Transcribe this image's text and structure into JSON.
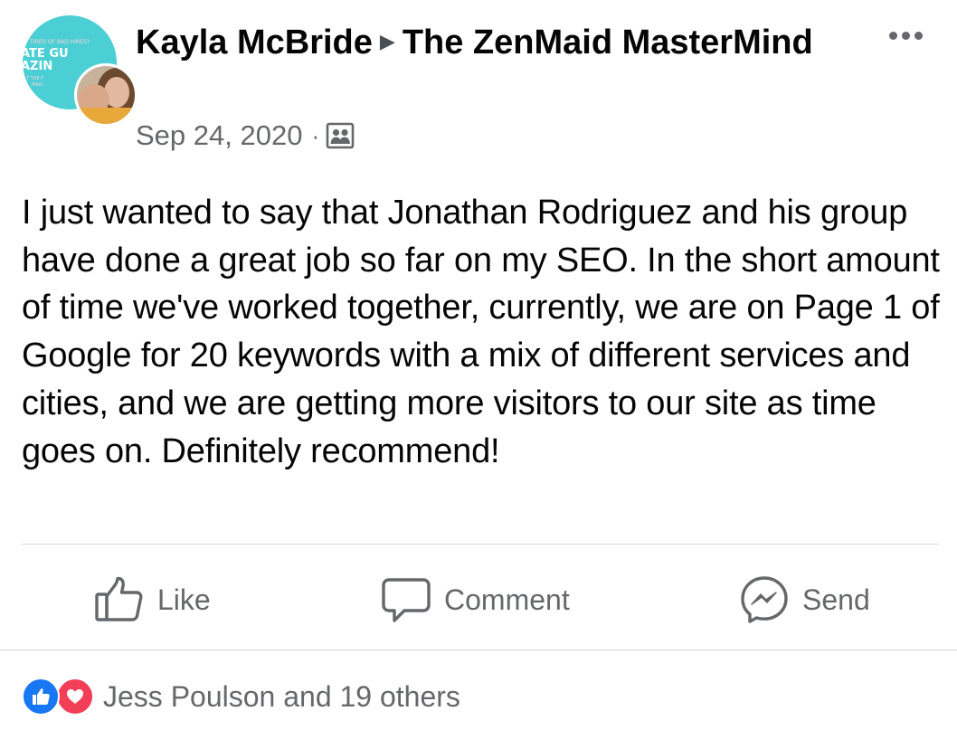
{
  "post": {
    "author": "Kayla McBride",
    "separator": "▶",
    "group": "The ZenMaid MasterMind",
    "date": "Sep 24, 2020",
    "meta_dot": "·",
    "privacy_icon": "group-members-icon",
    "more_icon": "more-options-icon",
    "text": "I just wanted to say that Jonathan Rodriguez and his group have done a great job so far on my SEO. In the short amount of time we've worked together, currently, we are on Page 1 of Google for 20 keywords with a mix of different services and cities, and we are getting more visitors to our site as time goes on. Definitely recommend!"
  },
  "group_avatar": {
    "lines": [
      "TIRED OF BAD HIRES?",
      "ATE GU",
      "AZIN",
      "T THE F",
      "MKID"
    ]
  },
  "actions": {
    "like": {
      "label": "Like",
      "icon": "thumbs-up-icon"
    },
    "comment": {
      "label": "Comment",
      "icon": "comment-bubble-icon"
    },
    "send": {
      "label": "Send",
      "icon": "messenger-icon"
    }
  },
  "reactions": {
    "icons": [
      "like-reaction-icon",
      "love-reaction-icon"
    ],
    "summary": "Jess Poulson and 19 others"
  },
  "colors": {
    "text_primary": "#050505",
    "text_secondary": "#65676b",
    "divider": "#d4d6da",
    "like_blue": "#1877f2",
    "love_red": "#f33e58",
    "group_avatar_teal": "#4ccfd4"
  }
}
